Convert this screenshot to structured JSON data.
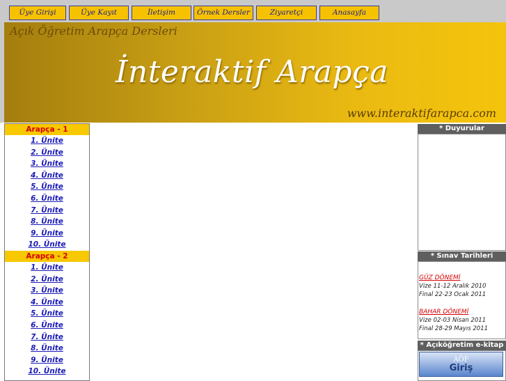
{
  "nav": {
    "items": [
      "Üye Girişi",
      "Üye Kayıt",
      "İletişim",
      "Örnek Dersler",
      "Ziyaretçi Defteri",
      "Anasayfa"
    ]
  },
  "banner": {
    "subtitle": "Açık Öğretim Arapça Dersleri",
    "title": "İnteraktif Arapça",
    "url": "www.interaktifarapca.com"
  },
  "leftmenu": {
    "sections": [
      {
        "title": "Arapça - 1",
        "units": [
          "1. Ünite",
          "2. Ünite",
          "3. Ünite",
          "4. Ünite",
          "5. Ünite",
          "6. Ünite",
          "7. Ünite",
          "8. Ünite",
          "9. Ünite",
          "10. Ünite"
        ]
      },
      {
        "title": "Arapça - 2",
        "units": [
          "1. Ünite",
          "2. Ünite",
          "3. Ünite",
          "4. Ünite",
          "5. Ünite",
          "6. Ünite",
          "7. Ünite",
          "8. Ünite",
          "9. Ünite",
          "10. Ünite"
        ]
      }
    ]
  },
  "right": {
    "duyurular_title": "* Duyurular",
    "sinav_title": "* Sınav Tarihleri",
    "guz": {
      "label": "GÜZ DÖNEMİ",
      "vize": "Vize 11-12 Aralık 2010",
      "final": "Final 22-23 Ocak 2011"
    },
    "bahar": {
      "label": "BAHAR DÖNEMİ",
      "vize": "Vize 02-03 Nisan 2011",
      "final": "Final 28-29 Mayıs 2011"
    },
    "ekitap_title": "* Açıköğretim e-kitap",
    "aof_label": "AÖF",
    "aof_giris": "Giriş"
  },
  "colors": {
    "nav_bg": "#f6c200",
    "banner_gold": "#eaba12",
    "section_head": "#f8c800",
    "link_blue": "#1a1ab8",
    "accent_red": "#d40000"
  }
}
